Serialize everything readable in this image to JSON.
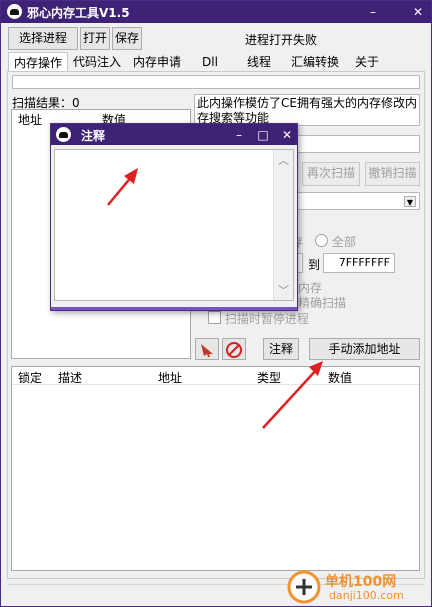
{
  "window": {
    "title": "邪心内存工具V1.5",
    "minimize_glyph": "–",
    "close_glyph": "✕"
  },
  "toolbar": {
    "select_process": "选择进程",
    "open": "打开",
    "save": "保存",
    "status": "进程打开失败"
  },
  "tabs": [
    {
      "label": "内存操作"
    },
    {
      "label": "代码注入"
    },
    {
      "label": "内存申请"
    },
    {
      "label": "Dll"
    },
    {
      "label": "线程"
    },
    {
      "label": "汇编转换"
    },
    {
      "label": "关于"
    }
  ],
  "scan": {
    "result_label": "扫描结果：0",
    "col_address": "地址",
    "col_value": "数值"
  },
  "info": {
    "description": "此内操作模仿了CE拥有强大的内存修改内存搜索等功能"
  },
  "buttons": {
    "rescan": "再次扫描",
    "undo_scan": "撤销扫描",
    "comment": "注释",
    "add_address": "手动添加地址"
  },
  "options": {
    "all": "全部",
    "to": "到",
    "range_end": "7FFFFFFF",
    "memory_partial": "内存",
    "precise_partial": "精确扫描",
    "pause_scan": "扫描时暂停进程"
  },
  "address_table": {
    "columns": [
      "锁定",
      "描述",
      "地址",
      "类型",
      "数值"
    ]
  },
  "comment_dialog": {
    "title": "注释",
    "minimize_glyph": "–",
    "maximize_glyph": "□",
    "close_glyph": "✕",
    "text": ""
  },
  "watermark": {
    "site_name": "单机100网",
    "site_url": "danji100.com"
  },
  "colors": {
    "titlebar": "#3e2276",
    "annotation_arrow": "#e02020",
    "watermark_orange": "#f08c1e"
  }
}
